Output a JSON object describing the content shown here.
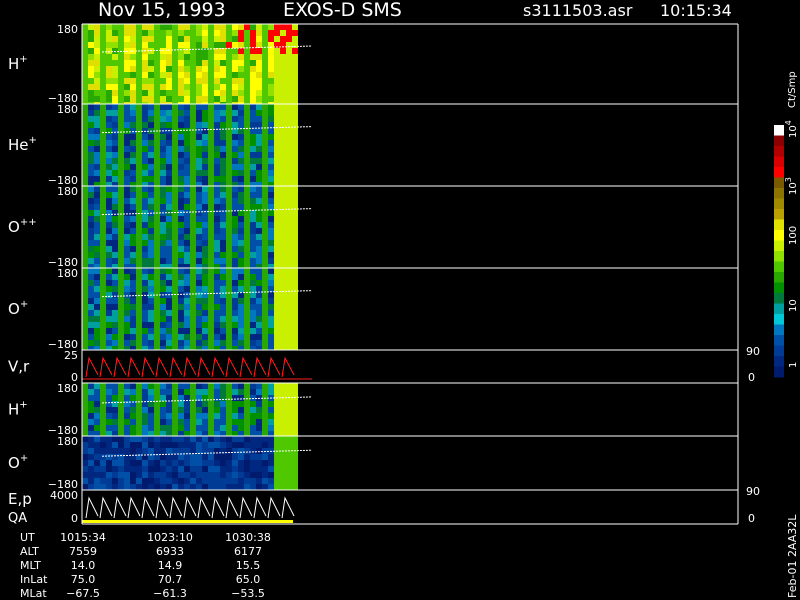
{
  "header": {
    "date": "Nov 15, 1993",
    "instrument": "EXOS-D SMS",
    "file": "s3111503.asr",
    "time": "10:15:34"
  },
  "colorbar": {
    "label": "Ct/Smp",
    "ticks": [
      {
        "base": "10",
        "exp": "4"
      },
      {
        "base": "10",
        "exp": "3"
      },
      {
        "base": "100",
        "exp": ""
      },
      {
        "base": "10",
        "exp": ""
      },
      {
        "base": "1",
        "exp": ""
      }
    ],
    "colors": [
      "#ffffff",
      "#8c0000",
      "#b00000",
      "#d80000",
      "#ff0000",
      "#7a5a00",
      "#8c7400",
      "#a08a00",
      "#b8a000",
      "#e0e000",
      "#ffff00",
      "#c8f000",
      "#90e000",
      "#50c800",
      "#28a800",
      "#009000",
      "#007a3c",
      "#00a0a0",
      "#00c8d8",
      "#0078c0",
      "#0050a8",
      "#003c96",
      "#002880",
      "#001a6e"
    ]
  },
  "chart_data": {
    "type": "heatmap",
    "panels": [
      {
        "species": "H",
        "charge": "+",
        "ymax": "180",
        "ymin": "−180",
        "intensity": "high"
      },
      {
        "species": "He",
        "charge": "+",
        "ymax": "180",
        "ymin": "−180",
        "intensity": "mid"
      },
      {
        "species": "O",
        "charge": "++",
        "ymax": "180",
        "ymin": "−180",
        "intensity": "mid"
      },
      {
        "species": "O",
        "charge": "+",
        "ymax": "180",
        "ymin": "−180",
        "intensity": "mid"
      },
      {
        "species": "V,r",
        "charge": "",
        "ymax": "25",
        "ymin": "0",
        "right_top": "90",
        "right_bottom": "0",
        "kind": "line"
      },
      {
        "species": "H",
        "charge": "+",
        "ymax": "180",
        "ymin": "−180",
        "intensity": "mid"
      },
      {
        "species": "O",
        "charge": "+",
        "ymax": "180",
        "ymin": "−180",
        "intensity": "low"
      },
      {
        "species": "E,p",
        "species2": "QA",
        "charge": "",
        "ymax": "4000",
        "ymin": "0",
        "right_top": "90",
        "right_bottom": "0",
        "kind": "line"
      }
    ],
    "time_axis": {
      "rows": [
        {
          "label": "UT",
          "values": [
            "1015:34",
            "1023:10",
            "1030:38"
          ]
        },
        {
          "label": "ALT",
          "values": [
            "7559",
            "6933",
            "6177"
          ]
        },
        {
          "label": "MLT",
          "values": [
            "14.0",
            "14.9",
            "15.5"
          ]
        },
        {
          "label": "InLat",
          "values": [
            "75.0",
            "70.7",
            "65.0"
          ]
        },
        {
          "label": "MLat",
          "values": [
            "−67.5",
            "−61.3",
            "−53.5"
          ]
        }
      ]
    }
  },
  "footer": {
    "stamp": "Feb-01 2AA32L"
  }
}
